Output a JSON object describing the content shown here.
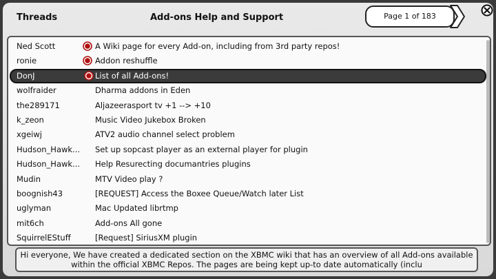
{
  "header": {
    "threads_label": "Threads",
    "forum_title": "Add-ons Help and Support",
    "pager": "Page 1 of 183"
  },
  "threads": [
    {
      "author": "Ned Scott",
      "subject": "A Wiki page for every Add-on, including from 3rd party repos!",
      "sticky": true
    },
    {
      "author": "ronie",
      "subject": "Addon reshuffle",
      "sticky": true
    },
    {
      "author": "DonJ",
      "subject": "List of all Add-ons!",
      "sticky": true
    },
    {
      "author": "wolfraider",
      "subject": "Dharma addons in Eden",
      "sticky": false
    },
    {
      "author": "the289171",
      "subject": "Aljazeerasport tv +1 --> +10",
      "sticky": false
    },
    {
      "author": "k_zeon",
      "subject": "Music Video Jukebox Broken",
      "sticky": false
    },
    {
      "author": "xgeiwj",
      "subject": "ATV2 audio channel select problem",
      "sticky": false
    },
    {
      "author": "Hudson_Hawk...",
      "subject": "Set up sopcast player as an external player for plugin",
      "sticky": false
    },
    {
      "author": "Hudson_Hawk...",
      "subject": "Help Resurecting documantries plugins",
      "sticky": false
    },
    {
      "author": "Mudin",
      "subject": "MTV Video play ?",
      "sticky": false
    },
    {
      "author": "boognish43",
      "subject": "[REQUEST] Access the Boxee Queue/Watch later List",
      "sticky": false
    },
    {
      "author": "uglyman",
      "subject": "Mac Updated librtmp",
      "sticky": false
    },
    {
      "author": "mit6ch",
      "subject": "Add-ons All gone",
      "sticky": false
    },
    {
      "author": "SquirrelEStuff",
      "subject": "[Request] SiriusXM plugin",
      "sticky": false
    }
  ],
  "selected_index": 2,
  "preview": {
    "line1": "Hi everyone, We have created a dedicated section on the XBMC wiki that has an overview of all Add-ons available",
    "line2": "within the official XBMC Repos. The pages are being kept up-to date automatically (inclu"
  },
  "colors": {
    "sticky_dot": "#b01010",
    "selected_bg": "#3b3b3b"
  }
}
